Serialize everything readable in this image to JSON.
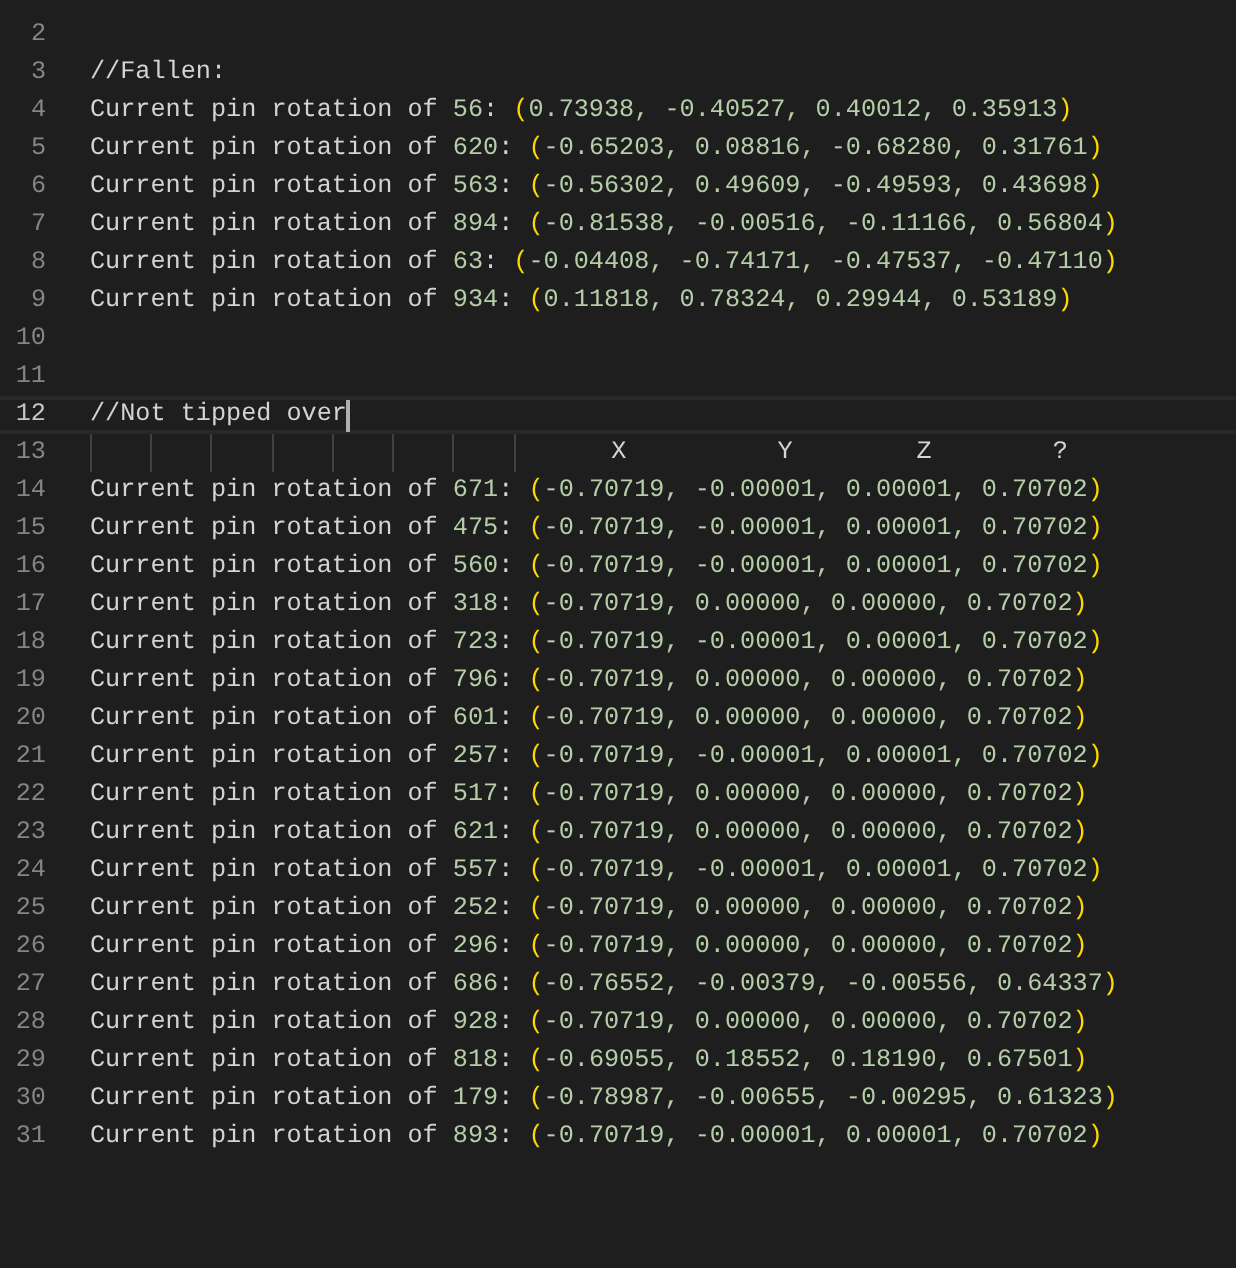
{
  "lines": [
    {
      "number": "2",
      "kind": "blank",
      "current": false
    },
    {
      "number": "3",
      "kind": "text",
      "text": "//Fallen:",
      "current": false
    },
    {
      "number": "4",
      "kind": "entry",
      "label": "Current pin rotation of",
      "pin": "56:",
      "open": "(",
      "values": "0.73938, -0.40527, 0.40012, 0.35913",
      "close": ")",
      "current": false
    },
    {
      "number": "5",
      "kind": "entry",
      "label": "Current pin rotation of",
      "pin": "620:",
      "open": "(",
      "values": "-0.65203, 0.08816, -0.68280, 0.31761",
      "close": ")",
      "current": false
    },
    {
      "number": "6",
      "kind": "entry",
      "label": "Current pin rotation of",
      "pin": "563:",
      "open": "(",
      "values": "-0.56302, 0.49609, -0.49593, 0.43698",
      "close": ")",
      "current": false
    },
    {
      "number": "7",
      "kind": "entry",
      "label": "Current pin rotation of",
      "pin": "894:",
      "open": "(",
      "values": "-0.81538, -0.00516, -0.11166, 0.56804",
      "close": ")",
      "current": false
    },
    {
      "number": "8",
      "kind": "entry",
      "label": "Current pin rotation of",
      "pin": "63:",
      "open": "(",
      "values": "-0.04408, -0.74171, -0.47537, -0.47110",
      "close": ")",
      "current": false
    },
    {
      "number": "9",
      "kind": "entry",
      "label": "Current pin rotation of",
      "pin": "934:",
      "open": "(",
      "values": "0.11818, 0.78324, 0.29944, 0.53189",
      "close": ")",
      "current": false
    },
    {
      "number": "10",
      "kind": "blank",
      "current": false
    },
    {
      "number": "11",
      "kind": "blank",
      "current": false
    },
    {
      "number": "12",
      "kind": "text",
      "text": "//Not tipped over",
      "current": true
    },
    {
      "number": "13",
      "kind": "header",
      "labels": [
        "X",
        "Y",
        "Z",
        "?"
      ],
      "current": false
    },
    {
      "number": "14",
      "kind": "entry",
      "label": "Current pin rotation of",
      "pin": "671:",
      "open": "(",
      "values": "-0.70719, -0.00001, 0.00001, 0.70702",
      "close": ")",
      "current": false
    },
    {
      "number": "15",
      "kind": "entry",
      "label": "Current pin rotation of",
      "pin": "475:",
      "open": "(",
      "values": "-0.70719, -0.00001, 0.00001, 0.70702",
      "close": ")",
      "current": false
    },
    {
      "number": "16",
      "kind": "entry",
      "label": "Current pin rotation of",
      "pin": "560:",
      "open": "(",
      "values": "-0.70719, -0.00001, 0.00001, 0.70702",
      "close": ")",
      "current": false
    },
    {
      "number": "17",
      "kind": "entry",
      "label": "Current pin rotation of",
      "pin": "318:",
      "open": "(",
      "values": "-0.70719, 0.00000, 0.00000, 0.70702",
      "close": ")",
      "current": false
    },
    {
      "number": "18",
      "kind": "entry",
      "label": "Current pin rotation of",
      "pin": "723:",
      "open": "(",
      "values": "-0.70719, -0.00001, 0.00001, 0.70702",
      "close": ")",
      "current": false
    },
    {
      "number": "19",
      "kind": "entry",
      "label": "Current pin rotation of",
      "pin": "796:",
      "open": "(",
      "values": "-0.70719, 0.00000, 0.00000, 0.70702",
      "close": ")",
      "current": false
    },
    {
      "number": "20",
      "kind": "entry",
      "label": "Current pin rotation of",
      "pin": "601:",
      "open": "(",
      "values": "-0.70719, 0.00000, 0.00000, 0.70702",
      "close": ")",
      "current": false
    },
    {
      "number": "21",
      "kind": "entry",
      "label": "Current pin rotation of",
      "pin": "257:",
      "open": "(",
      "values": "-0.70719, -0.00001, 0.00001, 0.70702",
      "close": ")",
      "current": false
    },
    {
      "number": "22",
      "kind": "entry",
      "label": "Current pin rotation of",
      "pin": "517:",
      "open": "(",
      "values": "-0.70719, 0.00000, 0.00000, 0.70702",
      "close": ")",
      "current": false
    },
    {
      "number": "23",
      "kind": "entry",
      "label": "Current pin rotation of",
      "pin": "621:",
      "open": "(",
      "values": "-0.70719, 0.00000, 0.00000, 0.70702",
      "close": ")",
      "current": false
    },
    {
      "number": "24",
      "kind": "entry",
      "label": "Current pin rotation of",
      "pin": "557:",
      "open": "(",
      "values": "-0.70719, -0.00001, 0.00001, 0.70702",
      "close": ")",
      "current": false
    },
    {
      "number": "25",
      "kind": "entry",
      "label": "Current pin rotation of",
      "pin": "252:",
      "open": "(",
      "values": "-0.70719, 0.00000, 0.00000, 0.70702",
      "close": ")",
      "current": false
    },
    {
      "number": "26",
      "kind": "entry",
      "label": "Current pin rotation of",
      "pin": "296:",
      "open": "(",
      "values": "-0.70719, 0.00000, 0.00000, 0.70702",
      "close": ")",
      "current": false
    },
    {
      "number": "27",
      "kind": "entry",
      "label": "Current pin rotation of",
      "pin": "686:",
      "open": "(",
      "values": "-0.76552, -0.00379, -0.00556, 0.64337",
      "close": ")",
      "current": false
    },
    {
      "number": "28",
      "kind": "entry",
      "label": "Current pin rotation of",
      "pin": "928:",
      "open": "(",
      "values": "-0.70719, 0.00000, 0.00000, 0.70702",
      "close": ")",
      "current": false
    },
    {
      "number": "29",
      "kind": "entry",
      "label": "Current pin rotation of",
      "pin": "818:",
      "open": "(",
      "values": "-0.69055, 0.18552, 0.18190, 0.67501",
      "close": ")",
      "current": false
    },
    {
      "number": "30",
      "kind": "entry",
      "label": "Current pin rotation of",
      "pin": "179:",
      "open": "(",
      "values": "-0.78987, -0.00655, -0.00295, 0.61323",
      "close": ")",
      "current": false
    },
    {
      "number": "31",
      "kind": "entry",
      "label": "Current pin rotation of",
      "pin": "893:",
      "open": "(",
      "values": "-0.70719, -0.00001, 0.00001, 0.70702",
      "close": ")",
      "current": false
    }
  ]
}
